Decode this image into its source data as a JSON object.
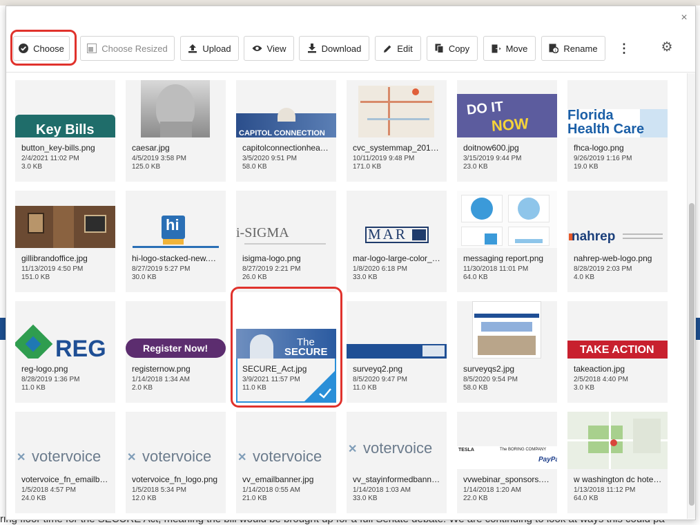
{
  "dialog": {
    "close_label": "×"
  },
  "toolbar": {
    "choose": "Choose",
    "choose_resized": "Choose Resized",
    "upload": "Upload",
    "view": "View",
    "download": "Download",
    "edit": "Edit",
    "copy": "Copy",
    "move": "Move",
    "rename": "Rename",
    "more": "⋮",
    "settings": "⚙"
  },
  "thumb_text": {
    "key_bills": "Key Bills",
    "capitol_connection": "CAPITOL CONNECTION",
    "do_it": "DO IT",
    "now": "NOW",
    "florida": "Florida",
    "health_care": "Health Care",
    "hi": "hi",
    "isigma": "i-SIGMA",
    "mar": "MAR",
    "nahrep": "nahrep",
    "reg": "REG",
    "register_now": "Register Now!",
    "the": "The",
    "secure": "SECURE",
    "take_action": "TAKE ACTION",
    "votervoice": "votervoice",
    "tesla": "TESLA",
    "boring": "The BORING COMPANY",
    "paypal": "PayPal"
  },
  "files": [
    {
      "name": "button_key-bills.png",
      "date": "2/4/2021 11:02 PM",
      "size": "3.0 KB"
    },
    {
      "name": "caesar.jpg",
      "date": "4/5/2019 3:58 PM",
      "size": "125.0 KB"
    },
    {
      "name": "capitolconnectionhea…",
      "date": "3/5/2020 9:51 PM",
      "size": "58.0 KB"
    },
    {
      "name": "cvc_systemmap_201…",
      "date": "10/11/2019 9:48 PM",
      "size": "171.0 KB"
    },
    {
      "name": "doitnow600.jpg",
      "date": "3/15/2019 9:44 PM",
      "size": "23.0 KB"
    },
    {
      "name": "fhca-logo.png",
      "date": "9/26/2019 1:16 PM",
      "size": "19.0 KB"
    },
    {
      "name": "gillibrandoffice.jpg",
      "date": "11/13/2019 4:50 PM",
      "size": "151.0 KB"
    },
    {
      "name": "hi-logo-stacked-new.…",
      "date": "8/27/2019 5:27 PM",
      "size": "30.0 KB"
    },
    {
      "name": "isigma-logo.png",
      "date": "8/27/2019 2:21 PM",
      "size": "26.0 KB"
    },
    {
      "name": "mar-logo-large-color_…",
      "date": "1/8/2020 6:18 PM",
      "size": "33.0 KB"
    },
    {
      "name": "messaging report.png",
      "date": "11/30/2018 11:01 PM",
      "size": "64.0 KB"
    },
    {
      "name": "nahrep-web-logo.png",
      "date": "8/28/2019 2:03 PM",
      "size": "4.0 KB"
    },
    {
      "name": "reg-logo.png",
      "date": "8/28/2019 1:36 PM",
      "size": "11.0 KB"
    },
    {
      "name": "registernow.png",
      "date": "1/14/2018 1:34 AM",
      "size": "2.0 KB"
    },
    {
      "name": "SECURE_Act.jpg",
      "date": "3/9/2021 11:57 PM",
      "size": "11.0 KB"
    },
    {
      "name": "surveyq2.png",
      "date": "8/5/2020 9:47 PM",
      "size": "11.0 KB"
    },
    {
      "name": "surveyqs2.jpg",
      "date": "8/5/2020 9:54 PM",
      "size": "58.0 KB"
    },
    {
      "name": "takeaction.jpg",
      "date": "2/5/2018 4:40 PM",
      "size": "3.0 KB"
    },
    {
      "name": "votervoice_fn_emailb…",
      "date": "1/5/2018 4:57 PM",
      "size": "24.0 KB"
    },
    {
      "name": "votervoice_fn_logo.png",
      "date": "1/5/2018 5:34 PM",
      "size": "12.0 KB"
    },
    {
      "name": "vv_emailbanner.jpg",
      "date": "1/14/2018 0:55 AM",
      "size": "21.0 KB"
    },
    {
      "name": "vv_stayinformedbann…",
      "date": "1/14/2018 1:03 AM",
      "size": "33.0 KB"
    },
    {
      "name": "vvwebinar_sponsors.…",
      "date": "1/14/2018 1:20 AM",
      "size": "22.0 KB"
    },
    {
      "name": "w washington dc hote…",
      "date": "1/13/2018 11:12 PM",
      "size": "64.0 KB"
    }
  ],
  "background": {
    "bottom_text": "ring floor time for the SECURE Act, meaning the bill would be brought up for a full Senate debate. We are continuing to look at ways this could pa"
  }
}
